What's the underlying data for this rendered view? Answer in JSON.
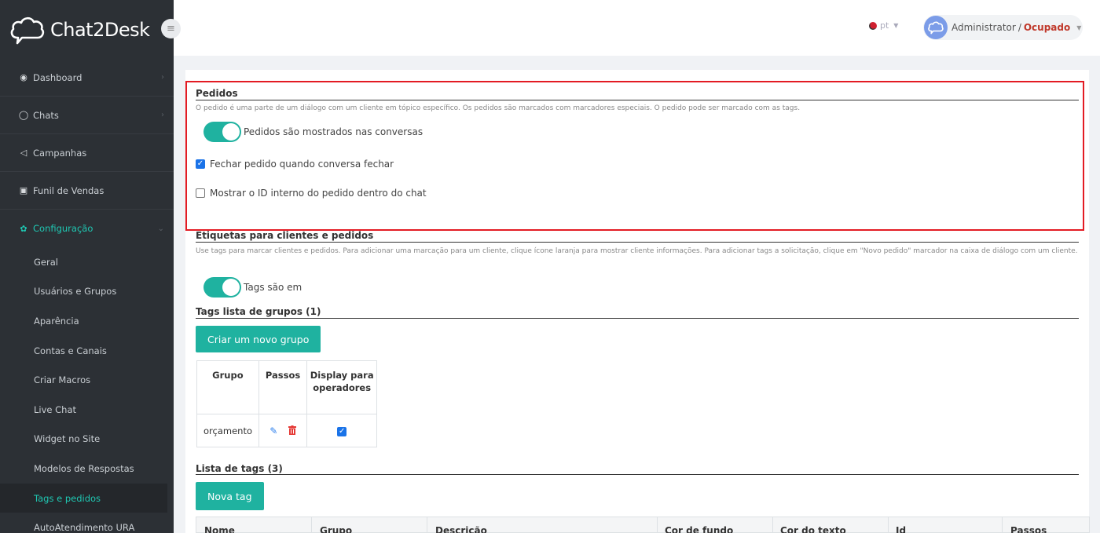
{
  "app": {
    "logo_text": "Chat2Desk"
  },
  "sidebar": {
    "main_items": [
      {
        "label": "Dashboard",
        "icon": "dashboard-icon"
      },
      {
        "label": "Chats",
        "icon": "chat-bubble-icon"
      },
      {
        "label": "Campanhas",
        "icon": "megaphone-icon"
      },
      {
        "label": "Funil de Vendas",
        "icon": "funnel-icon"
      },
      {
        "label": "Configuração",
        "icon": "gear-icon"
      }
    ],
    "sub_items": [
      "Geral",
      "Usuários e Grupos",
      "Aparência",
      "Contas e Canais",
      "Criar Macros",
      "Live Chat",
      "Widget no Site",
      "Modelos de Respostas",
      "Tags e pedidos",
      "AutoAtendimento URA"
    ],
    "accent_color": "#1fc8b3"
  },
  "topbar": {
    "language": "pt",
    "user_name": "Administrator",
    "separator": "/",
    "user_status": "Ocupado"
  },
  "orders": {
    "title": "Pedidos",
    "description": "O pedido é uma parte de um diálogo com um cliente em tópico específico. Os pedidos são marcados com marcadores especiais. O pedido pode ser marcado com as tags.",
    "toggle_label": "Pedidos são mostrados nas conversas",
    "toggle_on": true,
    "close_order_label": "Fechar pedido quando conversa fechar",
    "close_order_checked": true,
    "show_id_label": "Mostrar o ID interno do pedido dentro do chat",
    "show_id_checked": false
  },
  "labels": {
    "title": "Etiquetas para clientes e pedidos",
    "description": "Use tags para marcar clientes e pedidos. Para adicionar uma marcação para um cliente, clique ícone laranja para mostrar cliente informações. Para adicionar tags a solicitação, clique em \"Novo pedido\" marcador na caixa de diálogo com um cliente.",
    "toggle_label": "Tags são em",
    "toggle_on": true
  },
  "groups": {
    "title": "Tags lista de grupos (1)",
    "create_button": "Criar um novo grupo",
    "headers": [
      "Grupo",
      "Passos",
      "Display para operadores"
    ],
    "rows": [
      {
        "group": "orçamento",
        "display_for_operators": true
      }
    ]
  },
  "tags": {
    "title": "Lista de tags (3)",
    "new_button": "Nova tag",
    "headers": [
      "Nome",
      "Grupo",
      "Descrição",
      "Cor de fundo",
      "Cor do texto",
      "Id",
      "Passos"
    ]
  },
  "colors": {
    "highlight_border": "#e31b23",
    "primary": "#1fb2a0",
    "status_busy": "#c0392b"
  }
}
